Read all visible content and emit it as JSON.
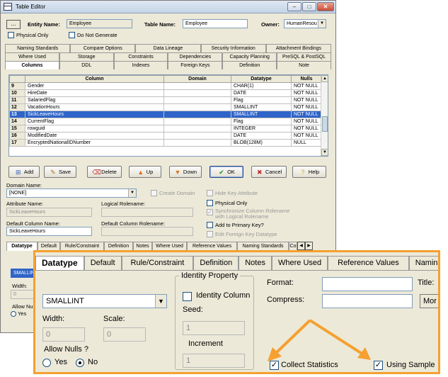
{
  "window": {
    "title": "Table Editor",
    "min_glyph": "–",
    "max_glyph": "□",
    "close_glyph": "✕"
  },
  "header": {
    "browse_button": "...",
    "entity_name_label": "Entity Name:",
    "entity_name_value": "Employee",
    "table_name_label": "Table Name:",
    "table_name_value": "Employee",
    "owner_label": "Owner:",
    "owner_value": "HumanResou",
    "physical_only_label": "Physical Only",
    "do_not_generate_label": "Do Not Generate"
  },
  "tabs": {
    "row1": [
      "Naming Standards",
      "Compare Options",
      "Data Lineage",
      "Security Information",
      "Attachment Bindings"
    ],
    "row2": [
      "Where Used",
      "Storage",
      "Constraints",
      "Dependencies",
      "Capacity Planning",
      "PreSQL & PostSQL"
    ],
    "row3": [
      "Columns",
      "DDL",
      "Indexes",
      "Foreign Keys",
      "Definition",
      "Note"
    ],
    "active": "Columns"
  },
  "grid": {
    "headers": [
      "Column",
      "Domain",
      "Datatype",
      "Nulls"
    ],
    "rows": [
      {
        "n": "9",
        "column": "Gender",
        "domain": "",
        "datatype": "CHAR(1)",
        "nulls": "NOT NULL"
      },
      {
        "n": "10",
        "column": "HireDate",
        "domain": "",
        "datatype": "DATE",
        "nulls": "NOT NULL"
      },
      {
        "n": "11",
        "column": "SalariedFlag",
        "domain": "",
        "datatype": "Flag",
        "nulls": "NOT NULL"
      },
      {
        "n": "12",
        "column": "VacationHours",
        "domain": "",
        "datatype": "SMALLINT",
        "nulls": "NOT NULL"
      },
      {
        "n": "13",
        "column": "SickLeaveHours",
        "domain": "",
        "datatype": "SMALLINT",
        "nulls": "NOT NULL",
        "selected": true
      },
      {
        "n": "14",
        "column": "CurrentFlag",
        "domain": "",
        "datatype": "Flag",
        "nulls": "NOT NULL"
      },
      {
        "n": "15",
        "column": "rowguid",
        "domain": "",
        "datatype": "INTEGER",
        "nulls": "NOT NULL"
      },
      {
        "n": "16",
        "column": "ModifiedDate",
        "domain": "",
        "datatype": "DATE",
        "nulls": "NOT NULL"
      },
      {
        "n": "17",
        "column": "EncryptedNationalIDNumber",
        "domain": "",
        "datatype": "BLOB(128M)",
        "nulls": "NULL"
      }
    ]
  },
  "actions": {
    "add": "Add",
    "save": "Save",
    "delete": "Delete",
    "up": "Up",
    "down": "Down",
    "ok": "OK",
    "cancel": "Cancel",
    "help": "Help"
  },
  "column_props": {
    "domain_name_label": "Domain Name:",
    "domain_value": "[NONE]",
    "create_domain_label": "Create Domain",
    "hide_key_attr_label": "Hide Key Attribute",
    "attribute_name_label": "Attribute Name:",
    "attribute_name_value": "SickLeaveHours",
    "logical_rolename_label": "Logical Rolename:",
    "physical_only_label": "Physical Only",
    "sync_label_1": "Synchronize Column Rolename",
    "sync_label_2": "with Logical Rolename",
    "default_column_name_label": "Default Column Name:",
    "default_column_name_value": "SickLeaveHours",
    "default_column_rolename_label": "Default Column Rolename:",
    "add_to_pk_label": "Add to Primary Key?",
    "edit_fk_label": "Edit Foreign Key Datatype"
  },
  "lower_tabs": [
    "Datatype",
    "Default",
    "Rule/Constraint",
    "Definition",
    "Notes",
    "Where Used",
    "Reference Values",
    "Naming Standards",
    "Co"
  ],
  "lower_partial": {
    "datatype_value": "SMALLIN",
    "width_label": "Width:",
    "width_value": "0",
    "allow_nulls_label": "Allow Null",
    "yes_label": "Yes"
  },
  "zoom": {
    "tabs": [
      "Datatype",
      "Default",
      "Rule/Constraint",
      "Definition",
      "Notes",
      "Where Used",
      "Reference Values",
      "Naming Sta"
    ],
    "datatype_value": "SMALLINT",
    "width_label": "Width:",
    "width_value": "0",
    "scale_label": "Scale:",
    "scale_value": "0",
    "allow_nulls_label": "Allow Nulls ?",
    "yes_label": "Yes",
    "no_label": "No",
    "identity_group_label": "Identity Property",
    "identity_column_label": "Identity Column",
    "seed_label": "Seed:",
    "seed_value": "1",
    "increment_label": "Increment",
    "increment_value": "1",
    "format_label": "Format:",
    "compress_label": "Compress:",
    "title_label": "Title:",
    "more_button": "Mor",
    "collect_statistics_label": "Collect Statistics",
    "using_sample_label": "Using Sample"
  },
  "colors": {
    "highlight": "#f5a030",
    "selection": "#2f64c8"
  }
}
